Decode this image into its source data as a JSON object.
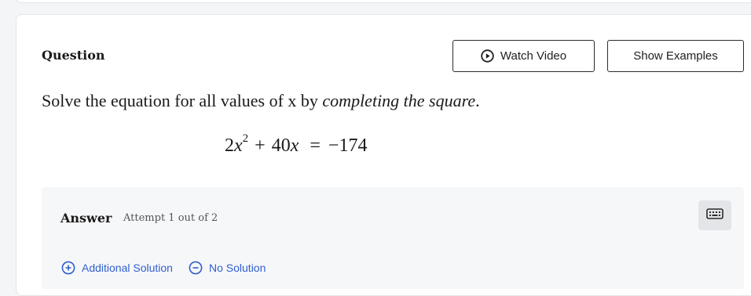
{
  "question": {
    "title": "Question",
    "watch_video_label": "Watch Video",
    "show_examples_label": "Show Examples",
    "prompt_text": "Solve the equation for all values of x by ",
    "prompt_emphasis": "completing the square",
    "prompt_end": ".",
    "equation": {
      "coef": "2",
      "var": "x",
      "exp": "2",
      "plus": "+",
      "linear_coef": "40",
      "linear_var": "x",
      "equals": "=",
      "rhs": "−174"
    }
  },
  "answer": {
    "label": "Answer",
    "attempt_text": "Attempt 1 out of 2",
    "additional_solution_label": "Additional Solution",
    "no_solution_label": "No Solution"
  },
  "icons": {
    "play": "play-circle-icon",
    "keyboard": "keyboard-icon",
    "plus": "plus-circle-icon",
    "minus": "minus-circle-icon"
  },
  "colors": {
    "link": "#2f5fce",
    "panel": "#f6f7f9"
  }
}
